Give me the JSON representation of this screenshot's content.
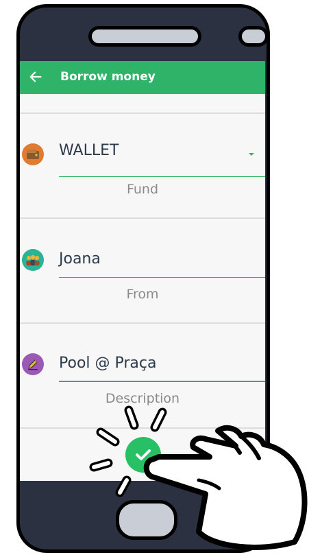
{
  "appbar": {
    "title": "Borrow money",
    "back_icon": "arrow-left-icon",
    "color": "#2eb368"
  },
  "form": {
    "fund": {
      "value": "WALLET",
      "label": "Fund",
      "icon": "wallet-icon",
      "icon_color": "#e07b2f"
    },
    "from": {
      "value": "Joana",
      "label": "From",
      "icon": "people-icon",
      "icon_color": "#2bb394"
    },
    "description": {
      "value": "Pool @ Praça",
      "label": "Description",
      "icon": "pencil-icon",
      "icon_color": "#9b59b6"
    },
    "confirm": {
      "icon": "checkmark-icon",
      "color": "#27c064"
    }
  },
  "overlay": {
    "hand_icon": "pointing-hand-icon"
  }
}
